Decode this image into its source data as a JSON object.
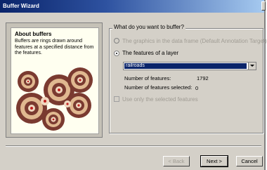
{
  "window": {
    "title": "Buffer Wizard"
  },
  "info": {
    "title": "About buffers",
    "text": "Buffers are rings drawn around features at a specified distance from the features."
  },
  "question": {
    "label": "What do you want to buffer?"
  },
  "options": [
    {
      "label": "The graphics in the data frame  (Default Annotation Target)",
      "checked": false,
      "enabled": false
    },
    {
      "label": "The features of a layer",
      "checked": true,
      "enabled": true
    }
  ],
  "layer_select": {
    "selected": "railroads"
  },
  "stats": {
    "num_features_label": "Number of features:",
    "num_features_value": "1792",
    "num_selected_label": "Number of features selected:",
    "num_selected_value": "0"
  },
  "use_selected": {
    "label": "Use only the selected features",
    "checked": false,
    "enabled": false
  },
  "buttons": {
    "back": "< Back",
    "next": "Next >",
    "cancel": "Cancel"
  },
  "colors": {
    "buffer_ring": "#8b4a3c",
    "buffer_fill": "#e8c8a0",
    "selection": "#0a246a"
  }
}
